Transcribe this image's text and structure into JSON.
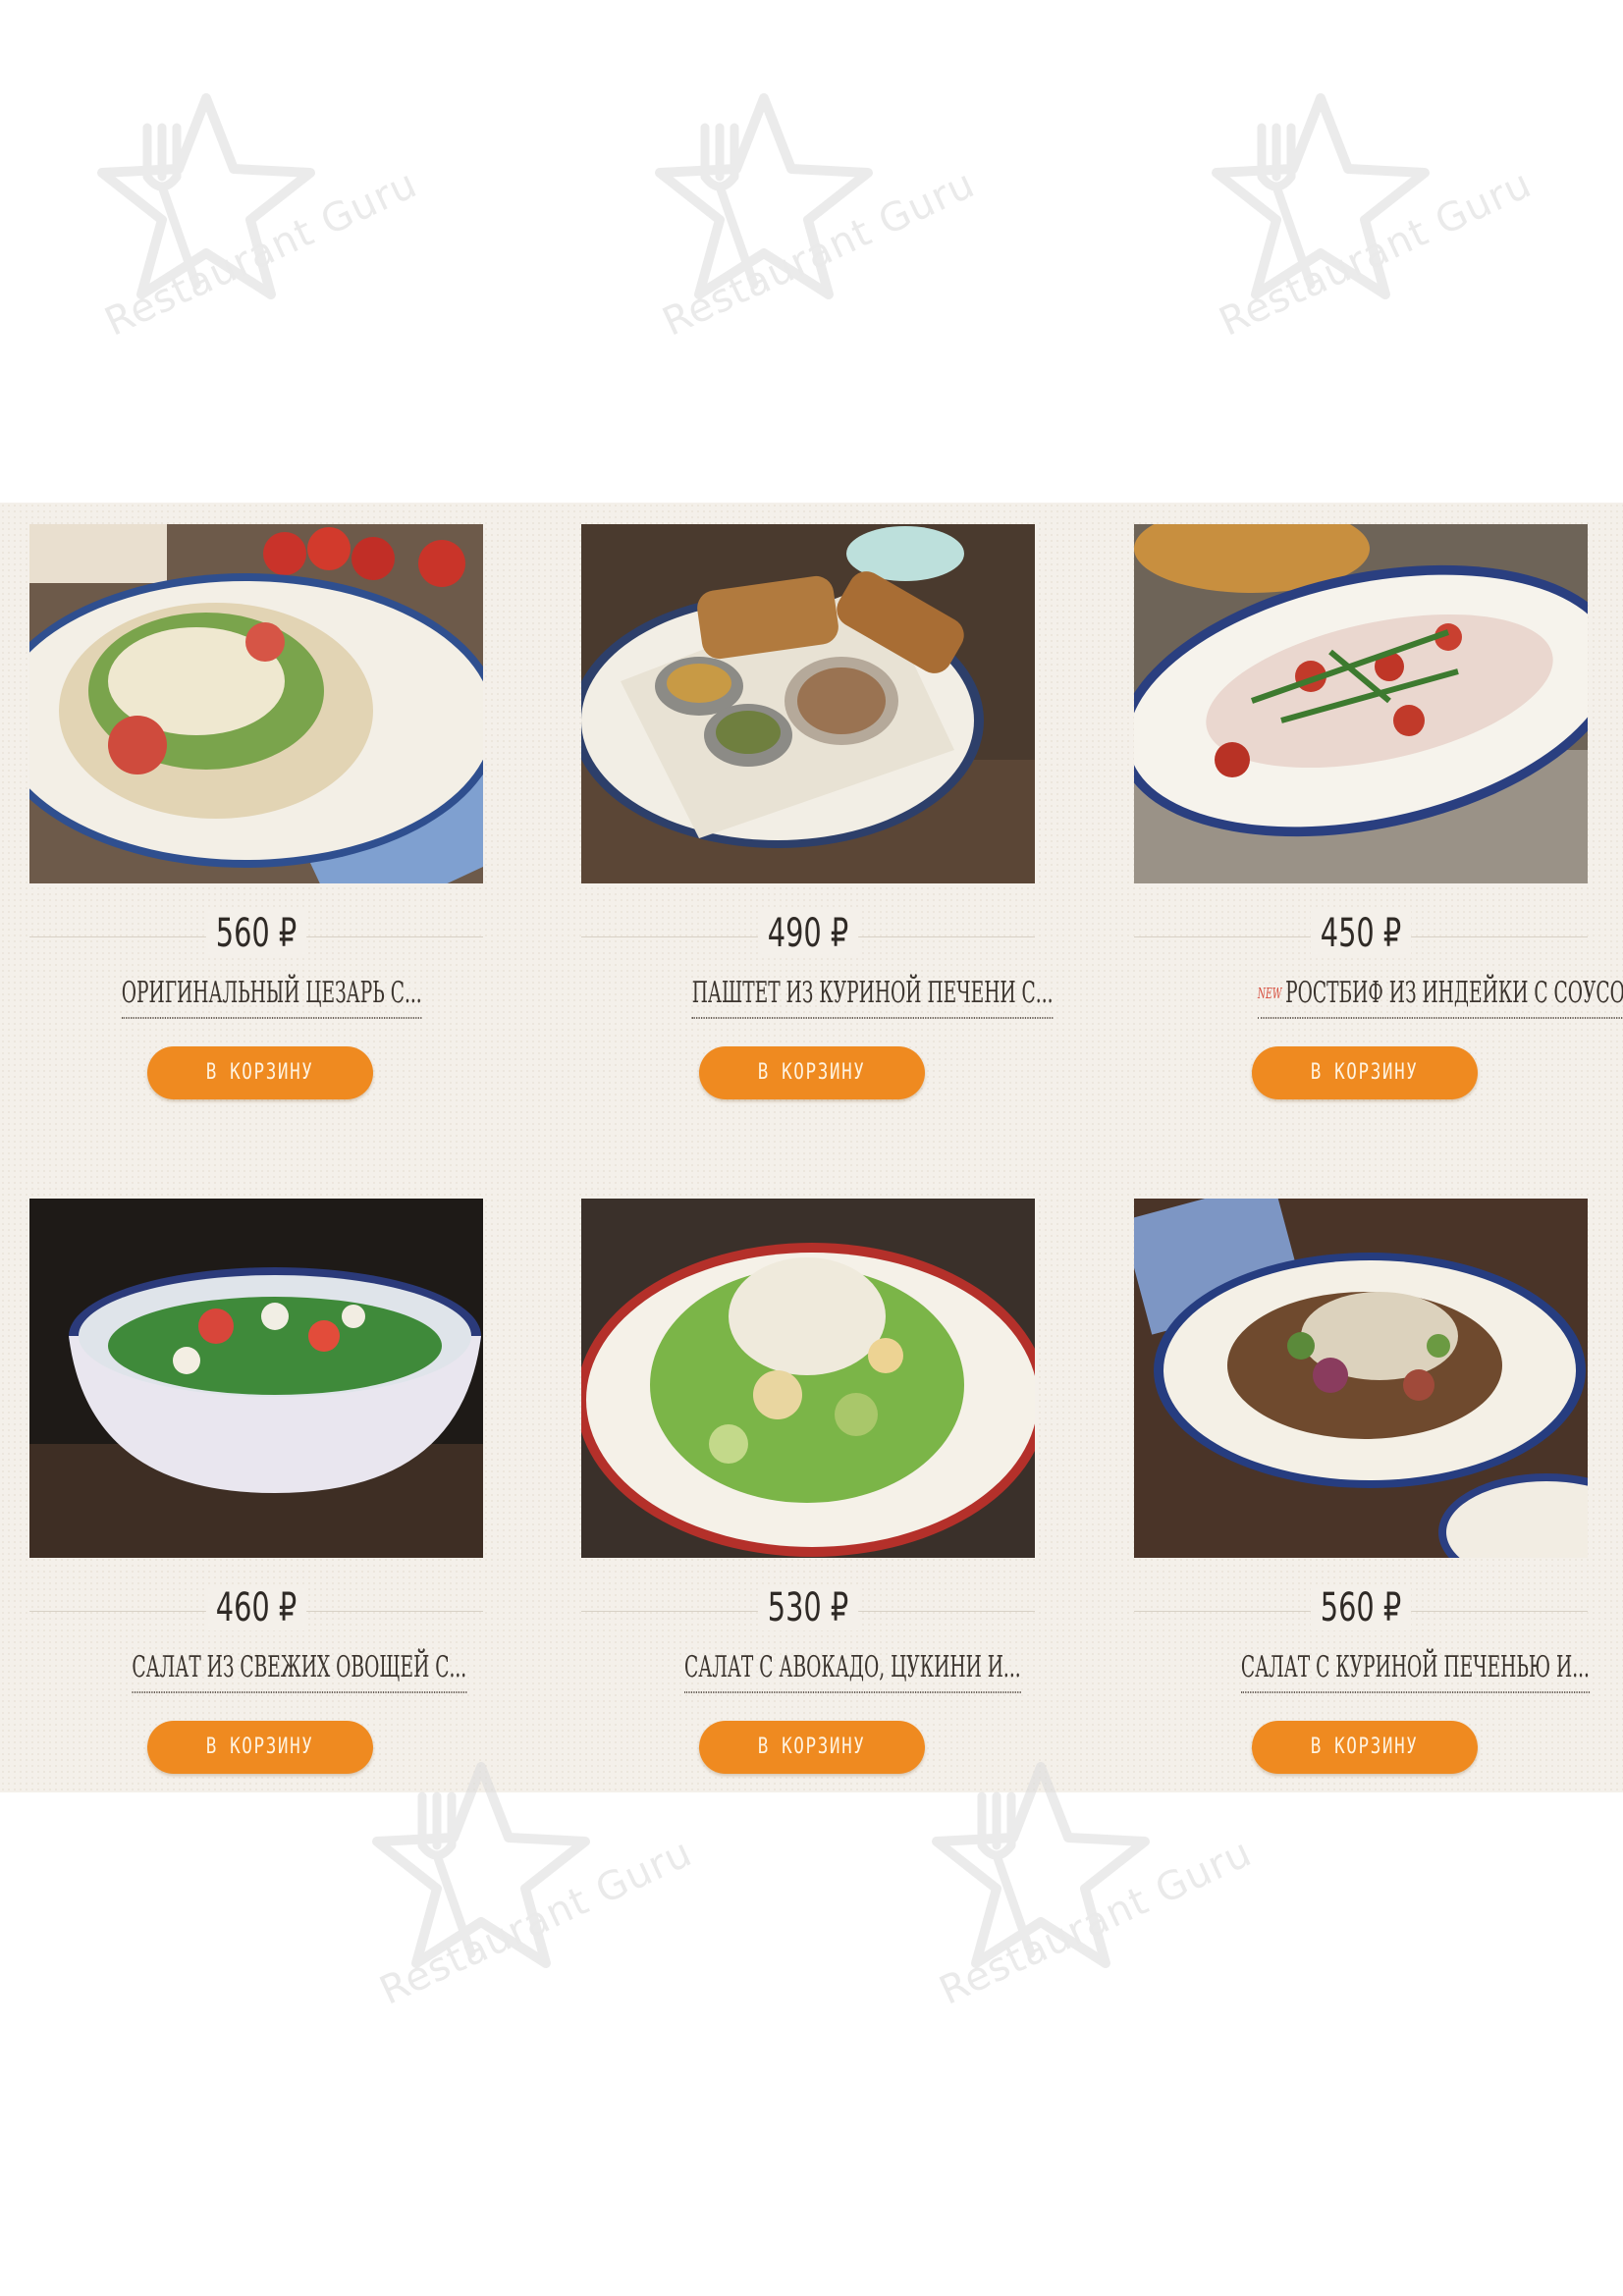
{
  "watermark": {
    "text": "Restaurant Guru"
  },
  "menu": {
    "currency": "₽",
    "items": [
      {
        "price": "560 ₽",
        "title": "ОРИГИНАЛЬНЫЙ ЦЕЗАРЬ С...",
        "button": "В КОРЗИНУ",
        "image": "caesar-salad-photo",
        "is_new": false
      },
      {
        "price": "490 ₽",
        "title": "ПАШТЕТ ИЗ КУРИНОЙ ПЕЧЕНИ С...",
        "button": "В КОРЗИНУ",
        "image": "chicken-liver-pate-photo",
        "is_new": false
      },
      {
        "price": "450 ₽",
        "title": "РОСТБИФ ИЗ ИНДЕЙКИ С СОУСОМ...",
        "button": "В КОРЗИНУ",
        "image": "turkey-roastbeef-photo",
        "is_new": true,
        "badge": "NEW"
      },
      {
        "price": "460 ₽",
        "title": "САЛАТ ИЗ СВЕЖИХ ОВОЩЕЙ С...",
        "button": "В КОРЗИНУ",
        "image": "fresh-vegetable-salad-photo",
        "is_new": false
      },
      {
        "price": "530 ₽",
        "title": "САЛАТ С АВОКАДО, ЦУКИНИ И...",
        "button": "В КОРЗИНУ",
        "image": "avocado-zucchini-salad-photo",
        "is_new": false
      },
      {
        "price": "560 ₽",
        "title": "САЛАТ С КУРИНОЙ ПЕЧЕНЬЮ И...",
        "button": "В КОРЗИНУ",
        "image": "chicken-liver-salad-photo",
        "is_new": false
      }
    ]
  },
  "colors": {
    "accent": "#ef8a20",
    "panel": "#f4f0ea",
    "text": "#3b342e",
    "new_badge": "#d64c3c"
  }
}
